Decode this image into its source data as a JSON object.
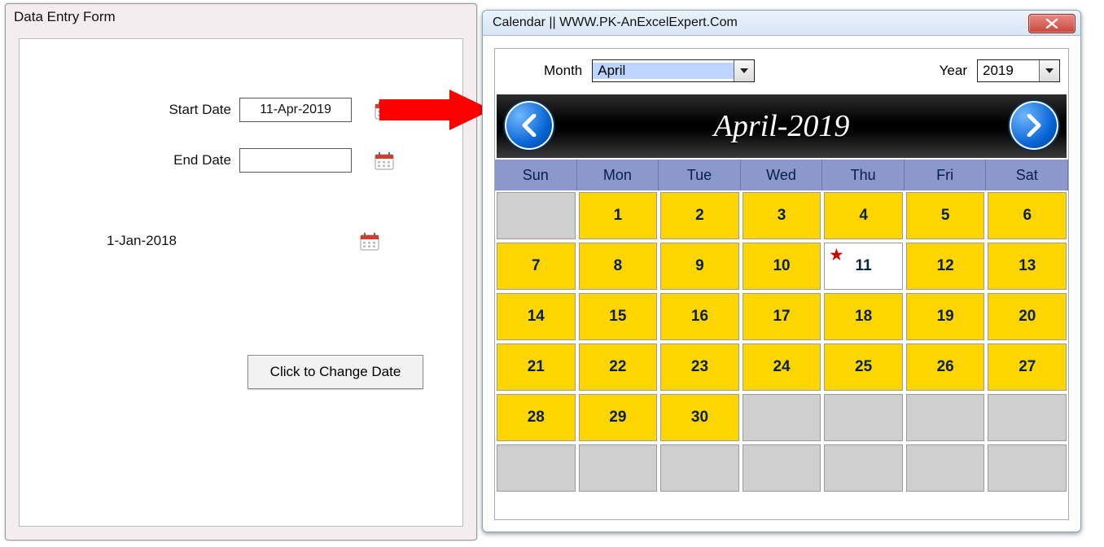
{
  "form": {
    "title": "Data Entry Form",
    "start_label": "Start Date",
    "end_label": "End Date",
    "start_value": "11-Apr-2019",
    "end_value": "",
    "default_date": "1-Jan-2018",
    "change_button": "Click to Change Date"
  },
  "calendar": {
    "title": "Calendar || WWW.PK-AnExcelExpert.Com",
    "month_label": "Month",
    "year_label": "Year",
    "month_value": "April",
    "year_value": "2019",
    "banner_title": "April-2019",
    "dow": [
      "Sun",
      "Mon",
      "Tue",
      "Wed",
      "Thu",
      "Fri",
      "Sat"
    ],
    "weeks": [
      [
        null,
        1,
        2,
        3,
        4,
        5,
        6
      ],
      [
        7,
        8,
        9,
        10,
        11,
        12,
        13
      ],
      [
        14,
        15,
        16,
        17,
        18,
        19,
        20
      ],
      [
        21,
        22,
        23,
        24,
        25,
        26,
        27
      ],
      [
        28,
        29,
        30,
        null,
        null,
        null,
        null
      ],
      [
        null,
        null,
        null,
        null,
        null,
        null,
        null
      ]
    ],
    "today": 11
  }
}
